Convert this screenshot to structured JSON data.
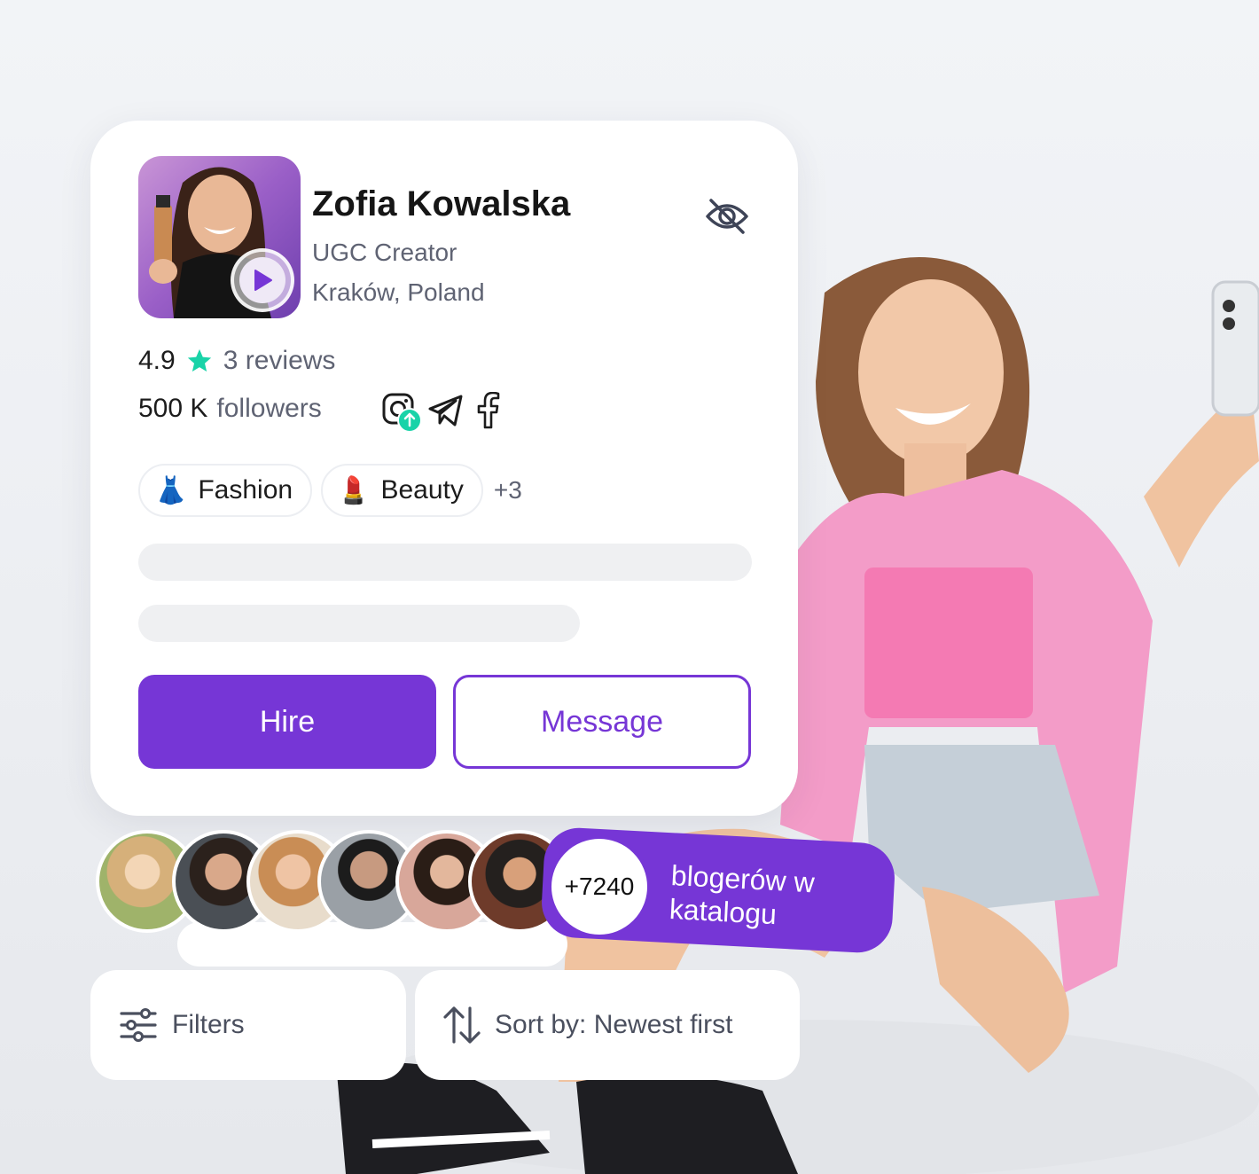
{
  "profile": {
    "name": "Zofia Kowalska",
    "role": "UGC Creator",
    "location": "Kraków, Poland",
    "rating": "4.9",
    "reviews": "3 reviews",
    "followers_count": "500 K",
    "followers_label": "followers"
  },
  "tags": [
    {
      "emoji": "👗",
      "label": "Fashion"
    },
    {
      "emoji": "💄",
      "label": "Beauty"
    }
  ],
  "more_tags": "+3",
  "actions": {
    "hire": "Hire",
    "message": "Message"
  },
  "catalog": {
    "count": "+7240",
    "text": "blogerów w katalogu"
  },
  "toolbar": {
    "filters": "Filters",
    "sort": "Sort by: Newest first"
  },
  "colors": {
    "accent": "#7636d6",
    "star": "#19d3a8",
    "text_muted": "#5f6373"
  },
  "icons": [
    "play-icon",
    "eye-off-icon",
    "star-icon",
    "instagram-icon",
    "upload-badge-icon",
    "telegram-icon",
    "facebook-icon",
    "sliders-icon",
    "sort-arrows-icon"
  ]
}
